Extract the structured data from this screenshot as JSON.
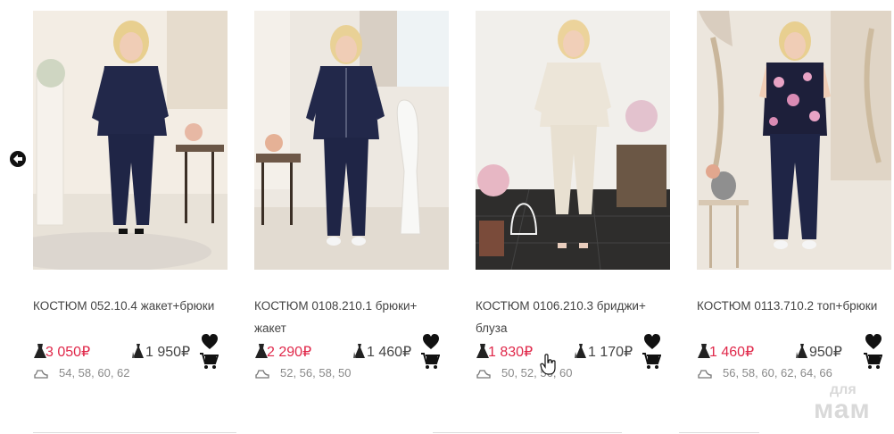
{
  "navigation": {
    "prev_icon": "arrow-left-circle-icon"
  },
  "products": [
    {
      "title": "КОСТЮМ 052.10.4 жакет+брюки",
      "retail_price": "3 050₽",
      "wholesale_price": "1 950₽",
      "sizes": "54, 58, 60, 62",
      "image": "woman-in-navy-jacket-and-trousers-photo"
    },
    {
      "title": "КОСТЮМ 0108.210.1 брюки+ жакет",
      "retail_price": "2 290₽",
      "wholesale_price": "1 460₽",
      "sizes": "52, 56, 58, 50",
      "image": "woman-in-navy-zip-jacket-and-trousers-photo"
    },
    {
      "title": "КОСТЮМ 0106.210.3 бриджи+ блуза",
      "retail_price": "1 830₽",
      "wholesale_price": "1 170₽",
      "sizes": "50, 52, 56, 60",
      "image": "woman-in-beige-blouse-and-breeches-photo"
    },
    {
      "title": "КОСТЮМ 0113.710.2 топ+брюки",
      "retail_price": "1 460₽",
      "wholesale_price": "950₽",
      "sizes": "56, 58, 60, 62, 64, 66",
      "image": "woman-in-floral-top-and-navy-trousers-photo"
    }
  ],
  "watermark": {
    "line1": "для",
    "line2": "мам"
  },
  "colors": {
    "price_retail": "#e0284a",
    "text": "#444444",
    "muted": "#8a8a8a",
    "outfit_navy": "#22284a",
    "outfit_beige": "#ece5d8"
  }
}
